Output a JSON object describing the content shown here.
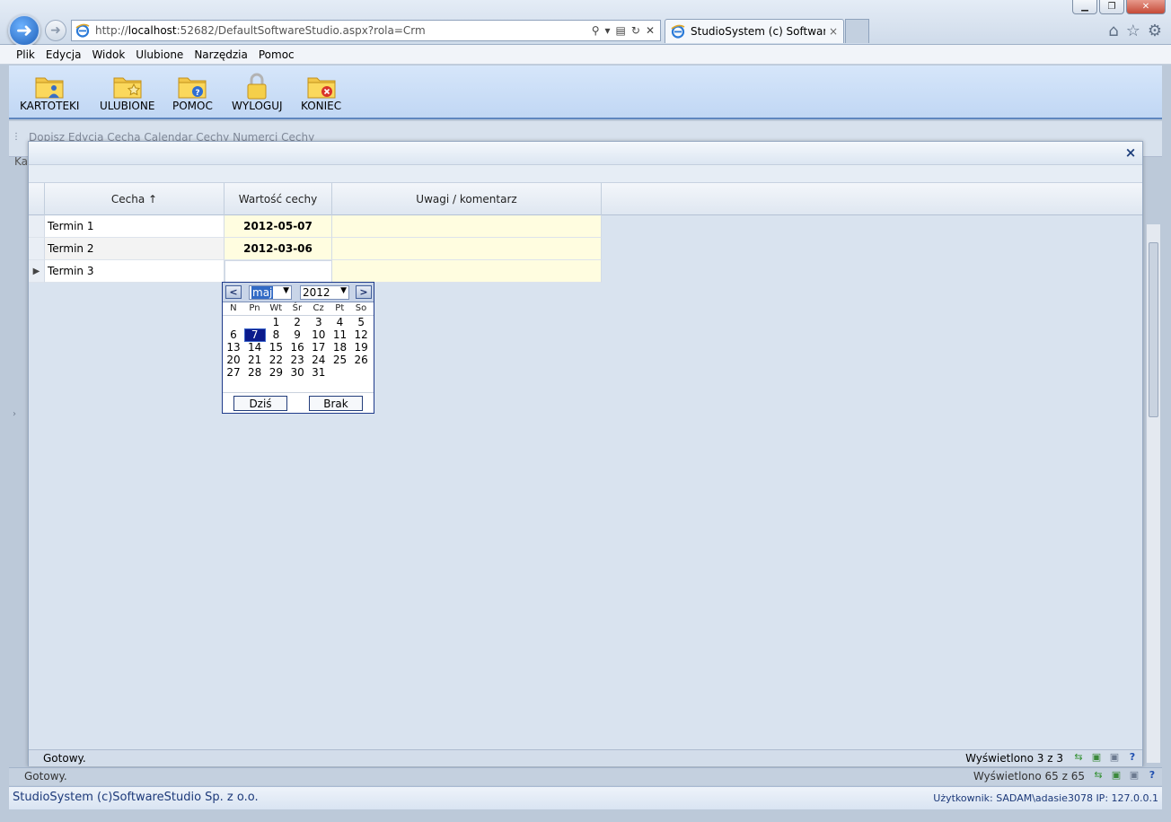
{
  "browser": {
    "url_prefix": "http://",
    "url_host": "localhost",
    "url_rest": ":52682/DefaultSoftwareStudio.aspx?rola=Crm",
    "tab_title": "StudioSystem (c) SoftwareS...",
    "tab_close": "×"
  },
  "menu": [
    {
      "label": "Plik"
    },
    {
      "label": "Edycja"
    },
    {
      "label": "Widok"
    },
    {
      "label": "Ulubione"
    },
    {
      "label": "Narzędzia"
    },
    {
      "label": "Pomoc"
    }
  ],
  "toolbar": {
    "buttons": [
      {
        "label": "KARTOTEKI",
        "icon": "folder-user-icon"
      },
      {
        "label": "ULUBIONE",
        "icon": "folder-star-icon"
      },
      {
        "label": "POMOC",
        "icon": "folder-help-icon"
      },
      {
        "label": "WYLOGUJ",
        "icon": "padlock-icon"
      },
      {
        "label": "KONIEC",
        "icon": "folder-close-icon"
      }
    ]
  },
  "underlying": {
    "breadcrumb": "Dopisz  Edycja  Cecha Calendar  Cechy Numerci  Cechy",
    "ka": "Ka"
  },
  "dialog": {
    "close_label": "×",
    "columns": {
      "cecha": "Cecha",
      "sort_indicator": "↑",
      "wartosc": "Wartość cechy",
      "uwagi": "Uwagi / komentarz"
    },
    "rows": [
      {
        "name": "Termin 1",
        "value": "2012-05-07",
        "comment": ""
      },
      {
        "name": "Termin 2",
        "value": "2012-03-06",
        "comment": ""
      },
      {
        "name": "Termin 3",
        "value": "",
        "comment": "",
        "current": true
      }
    ],
    "status": "Gotowy.",
    "count": "Wyświetlono 3 z 3"
  },
  "calendar": {
    "month": "maj",
    "year": "2012",
    "weekdays": [
      "N",
      "Pn",
      "Wt",
      "Śr",
      "Cz",
      "Pt",
      "So"
    ],
    "first_weekday_index": 2,
    "days_in_month": 31,
    "selected_day": 7,
    "today_label": "Dziś",
    "none_label": "Brak"
  },
  "page_status": {
    "status": "Gotowy.",
    "count": "Wyświetlono 65 z 65"
  },
  "footer": {
    "copyright": "StudioSystem (c)SoftwareStudio Sp. z o.o.",
    "user_info": "Użytkownik: SADAM\\adasie3078 IP: 127.0.0.1"
  },
  "colors": {
    "accent": "#1d3a7a",
    "cell_highlight": "#fffde0",
    "selected_day": "#0a1a8c"
  }
}
